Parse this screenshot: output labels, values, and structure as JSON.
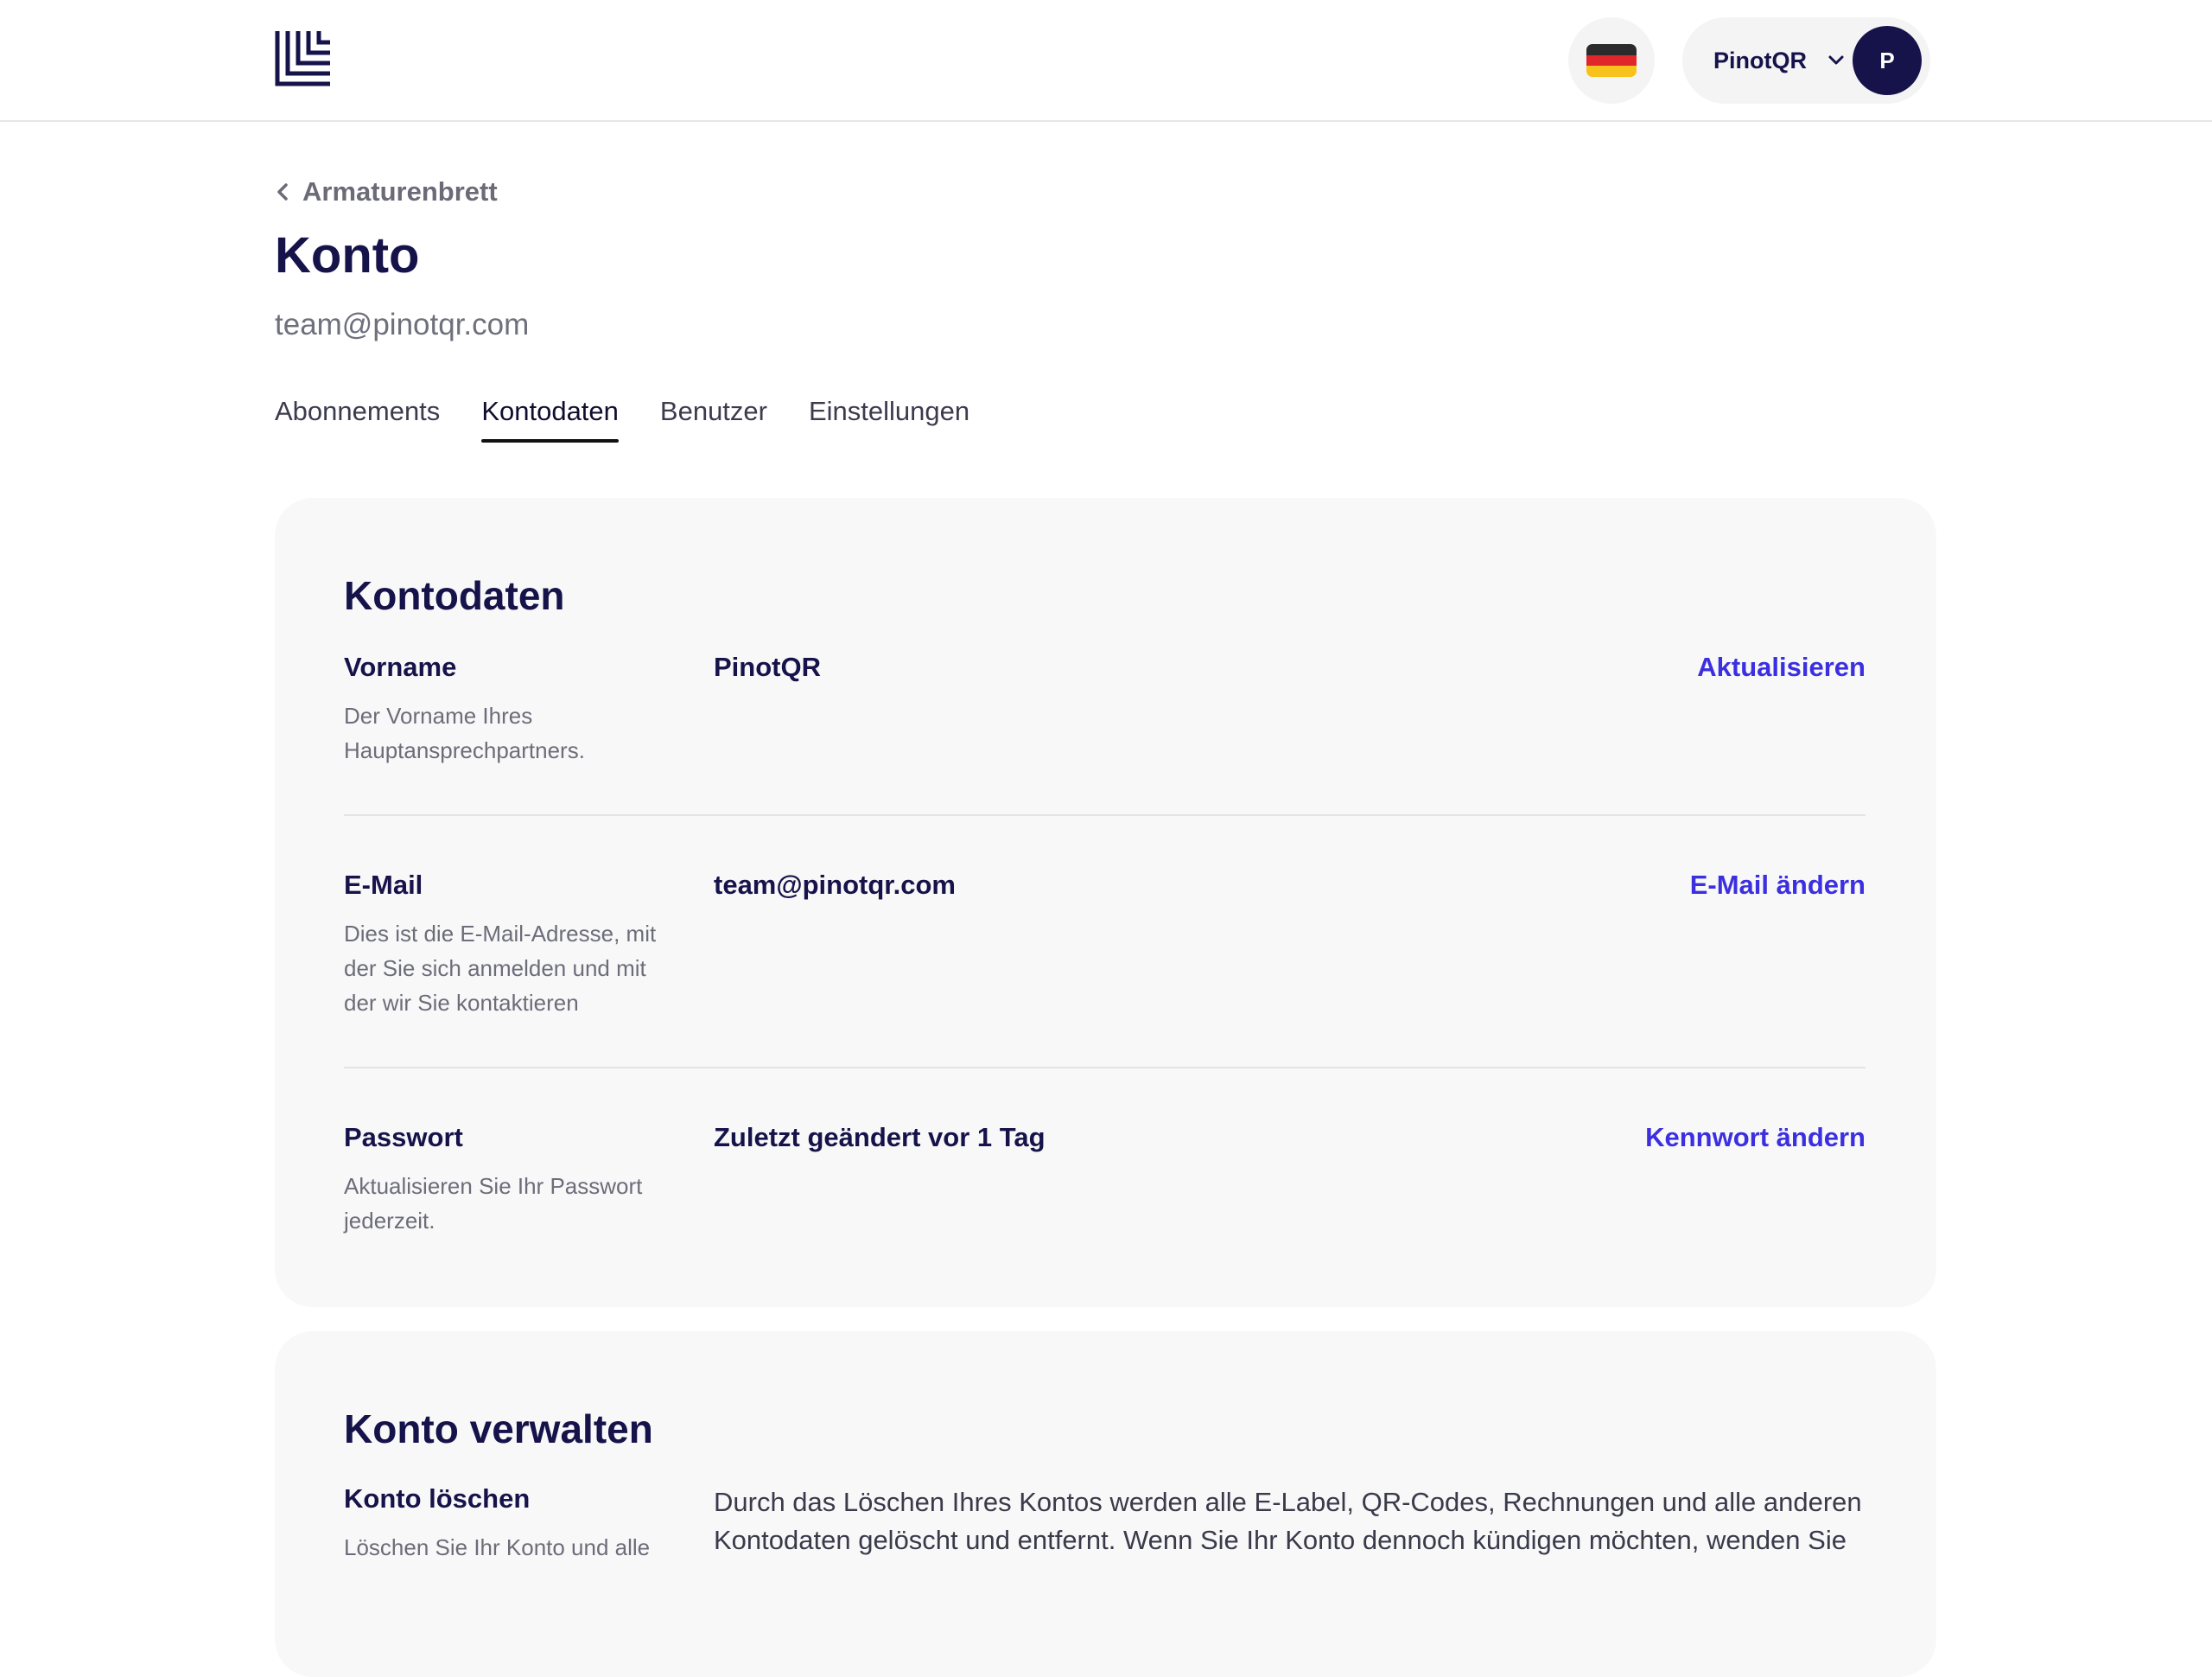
{
  "header": {
    "language_flag": "german-flag-icon",
    "user_name": "PinotQR",
    "avatar_initial": "P"
  },
  "page": {
    "back_label": "Armaturenbrett",
    "title": "Konto",
    "email": "team@pinotqr.com"
  },
  "tabs": [
    {
      "label": "Abonnements",
      "active": false
    },
    {
      "label": "Kontodaten",
      "active": true
    },
    {
      "label": "Benutzer",
      "active": false
    },
    {
      "label": "Einstellungen",
      "active": false
    }
  ],
  "account_data": {
    "title": "Kontodaten",
    "rows": [
      {
        "label": "Vorname",
        "desc": "Der Vorname Ihres Hauptansprechpartners.",
        "value": "PinotQR",
        "action": "Aktualisieren"
      },
      {
        "label": "E-Mail",
        "desc": "Dies ist die E-Mail-Adresse, mit der Sie sich anmelden und mit der wir Sie kontaktieren",
        "value": "team@pinotqr.com",
        "action": "E-Mail ändern"
      },
      {
        "label": "Passwort",
        "desc": "Aktualisieren Sie Ihr Passwort jederzeit.",
        "value": "Zuletzt geändert vor 1 Tag",
        "action": "Kennwort ändern"
      }
    ]
  },
  "manage": {
    "title": "Konto verwalten",
    "delete_label": "Konto löschen",
    "delete_desc": "Löschen Sie Ihr Konto und alle",
    "delete_text": "Durch das Löschen Ihres Kontos werden alle E-Label, QR-Codes, Rechnungen und alle anderen Kontodaten gelöscht und entfernt. Wenn Sie Ihr Konto dennoch kündigen möchten, wenden Sie"
  },
  "colors": {
    "brand": "#16134a",
    "link": "#3b2fe0"
  }
}
